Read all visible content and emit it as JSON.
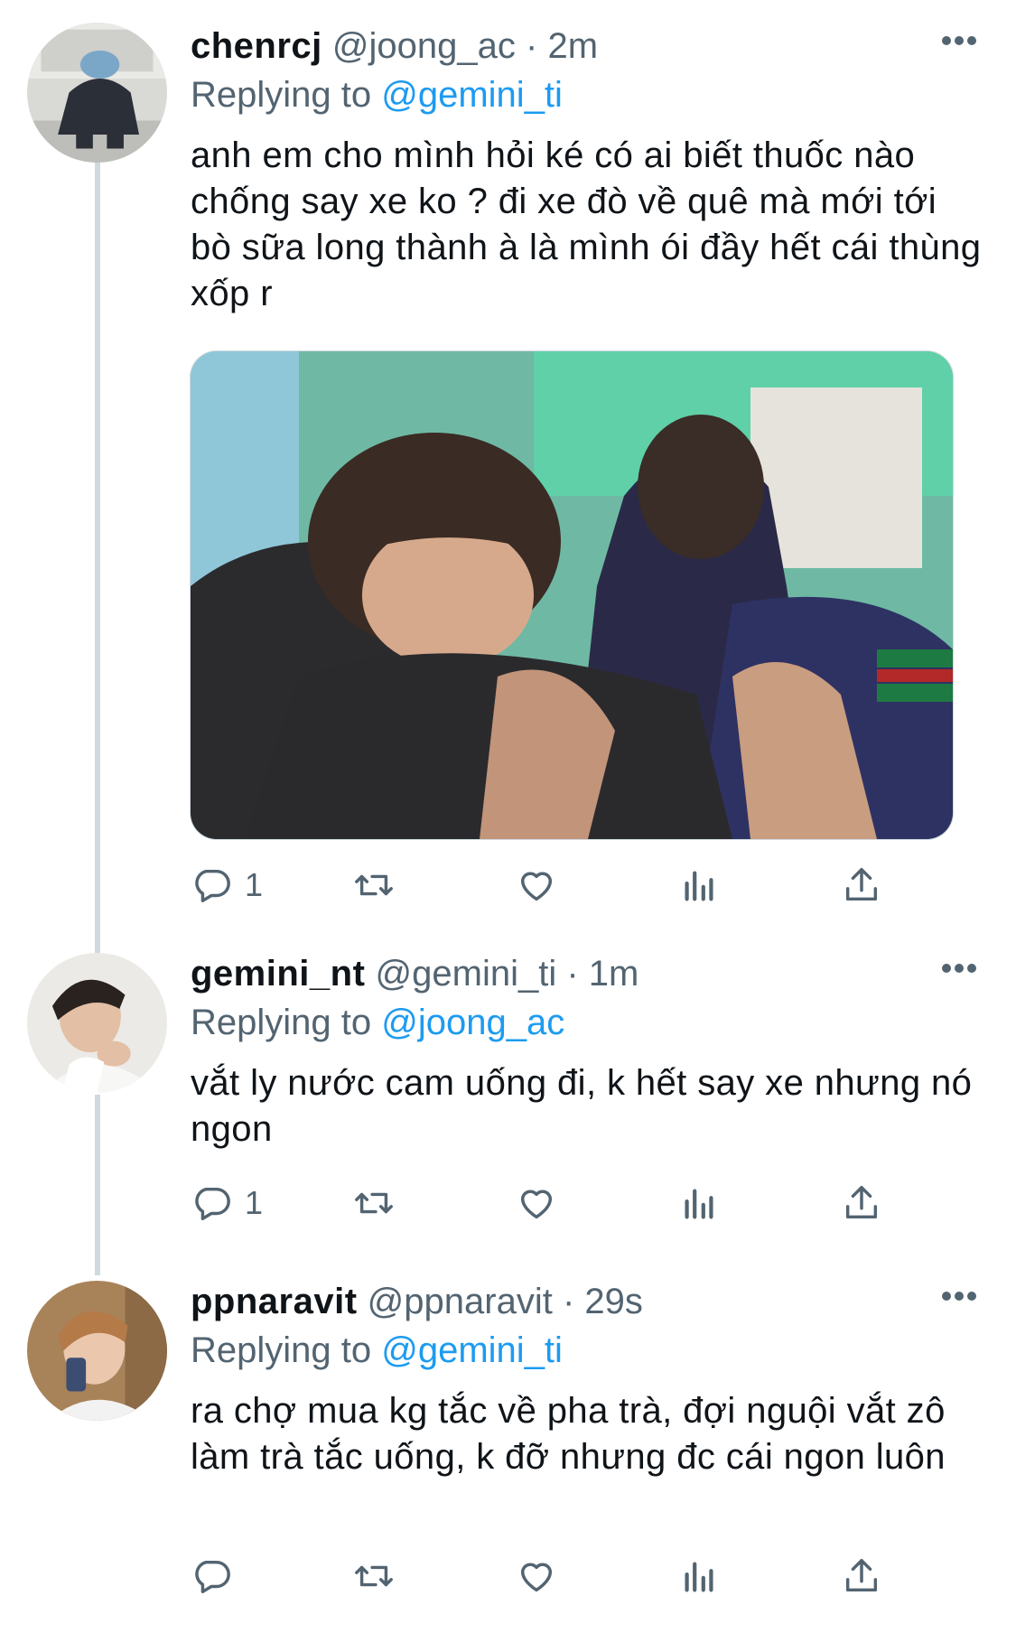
{
  "tweets": [
    {
      "name": "chenrcj",
      "handle": "@joong_ac",
      "separator": "·",
      "time": "2m",
      "replying_prefix": "Replying to",
      "replying_to": "@gemini_ti",
      "text": "anh em cho mình hỏi ké có ai biết thuốc nào chống say xe ko ? đi xe đò về quê mà mới tới bò sữa long thành à là mình ói đầy hết cái thùng xốp r",
      "reply_count": "1"
    },
    {
      "name": "gemini_nt",
      "handle": "@gemini_ti",
      "separator": "·",
      "time": "1m",
      "replying_prefix": "Replying to",
      "replying_to": "@joong_ac",
      "text": "vắt ly nước cam uống đi, k hết say xe nhưng nó ngon",
      "reply_count": "1"
    },
    {
      "name": "ppnaravit",
      "handle": "@ppnaravit",
      "separator": "·",
      "time": "29s",
      "replying_prefix": "Replying to",
      "replying_to": "@gemini_ti",
      "text": "ra chợ mua kg tắc về pha trà, đợi nguội vắt zô làm trà tắc uống, k đỡ nhưng đc cái ngon luôn",
      "reply_count": ""
    }
  ],
  "icons": {
    "reply": "reply-icon",
    "retweet": "retweet-icon",
    "like": "heart-icon",
    "analytics": "analytics-icon",
    "share": "share-icon",
    "more": "more-icon"
  },
  "colors": {
    "link": "#1d9bf0",
    "secondary_text": "#536471",
    "primary_text": "#0f1419",
    "thread_line": "#cfd9de"
  }
}
